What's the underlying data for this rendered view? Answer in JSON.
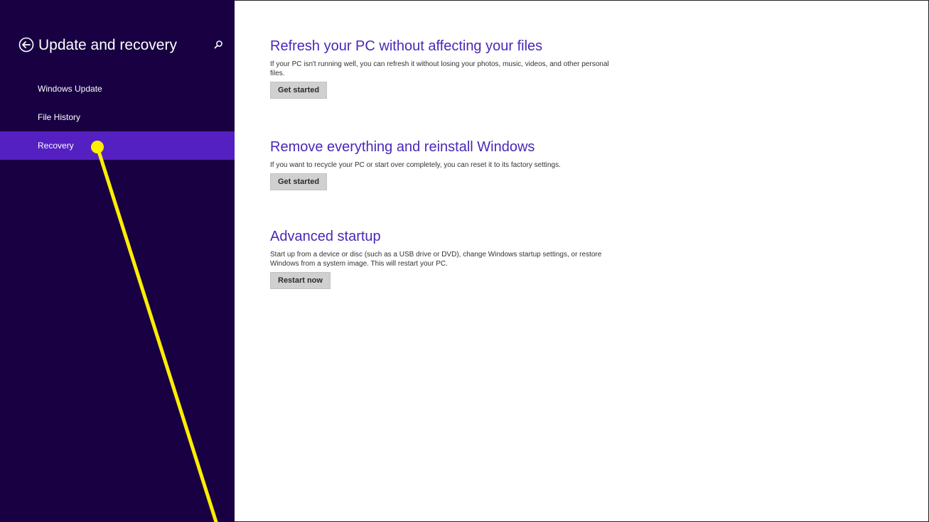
{
  "sidebar": {
    "title": "Update and recovery",
    "back_icon": "back-arrow-circle-icon",
    "search_icon": "search-icon",
    "items": [
      {
        "label": "Windows Update",
        "selected": false
      },
      {
        "label": "File History",
        "selected": false
      },
      {
        "label": "Recovery",
        "selected": true
      }
    ]
  },
  "main": {
    "sections": [
      {
        "title": "Refresh your PC without affecting your files",
        "description": "If your PC isn't running well, you can refresh it without losing your photos, music, videos, and other personal files.",
        "button_label": "Get started"
      },
      {
        "title": "Remove everything and reinstall Windows",
        "description": "If you want to recycle your PC or start over completely, you can reset it to its factory settings.",
        "button_label": "Get started"
      },
      {
        "title": "Advanced startup",
        "description": "Start up from a device or disc (such as a USB drive or DVD), change Windows startup settings, or restore Windows from a system image. This will restart your PC.",
        "button_label": "Restart now"
      }
    ]
  },
  "colors": {
    "sidebar_bg": "#180042",
    "selected_bg": "#5520c2",
    "heading": "#4a28b8",
    "annotation": "#ffee00"
  }
}
